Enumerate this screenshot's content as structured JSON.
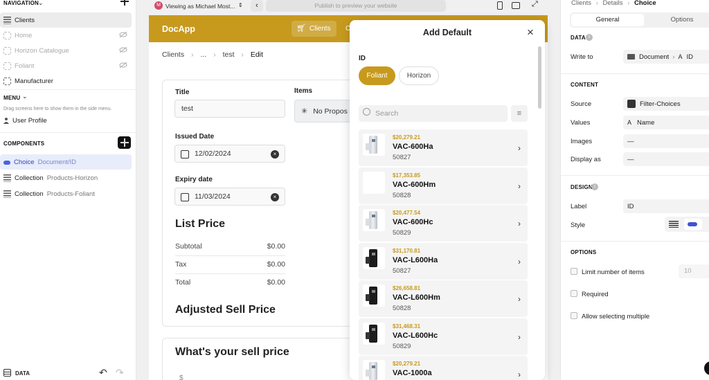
{
  "left_panel": {
    "navigation_header": "NAVIGATION",
    "nav_items": [
      {
        "label": "Clients"
      },
      {
        "label": "Home"
      },
      {
        "label": "Horizon Catalogue"
      },
      {
        "label": "Foliant"
      },
      {
        "label": "Manufacturer"
      }
    ],
    "menu_header": "MENU",
    "menu_hint": "Drag screens here to show them in the side menu.",
    "menu_item": "User Profile",
    "components_header": "COMPONENTS",
    "components": [
      {
        "type": "Choice",
        "source": "Document/ID"
      },
      {
        "type": "Collection",
        "source": "Products-Horizon"
      },
      {
        "type": "Collection",
        "source": "Products-Foliant"
      }
    ],
    "footer_label": "DATA"
  },
  "topbar": {
    "viewing_as": "Viewing as Michael Most...",
    "avatar_letter": "M",
    "publish_placeholder": "Publish to preview your website"
  },
  "app": {
    "title": "DocApp",
    "header_tab": "Clients",
    "header_tab2": "C",
    "breadcrumb": [
      "Clients",
      "...",
      "test",
      "Edit"
    ],
    "title_label": "Title",
    "title_value": "test",
    "items_label": "Items",
    "items_value": "No Propos",
    "issued_label": "Issued Date",
    "issued_value": "12/02/2024",
    "expiry_label": "Expiry date",
    "expiry_value": "11/03/2024",
    "list_price_heading": "List Price",
    "subtotal_label": "Subtotal",
    "subtotal_value": "$0.00",
    "tax_label": "Tax",
    "tax_value": "$0.00",
    "total_label": "Total",
    "total_value": "$0.00",
    "adjusted_heading": "Adjusted Sell Price",
    "sell_heading": "What's your sell price",
    "sell_prefix": "$"
  },
  "modal": {
    "title": "Add Default",
    "id_label": "ID",
    "chips": [
      "Foliant",
      "Horizon"
    ],
    "search_placeholder": "Search",
    "items": [
      {
        "price": "$20,279.21",
        "name": "VAC-600Ha",
        "code": "50827",
        "img": "silver"
      },
      {
        "price": "$17,353.85",
        "name": "VAC-600Hm",
        "code": "50828",
        "img": "none"
      },
      {
        "price": "$20,477.54",
        "name": "VAC-600Hc",
        "code": "50829",
        "img": "silver"
      },
      {
        "price": "$31,170.81",
        "name": "VAC-L600Ha",
        "code": "50827",
        "img": "black"
      },
      {
        "price": "$26,658.81",
        "name": "VAC-L600Hm",
        "code": "50828",
        "img": "black"
      },
      {
        "price": "$31,468.31",
        "name": "VAC-L600Hc",
        "code": "50829",
        "img": "black"
      },
      {
        "price": "$20,279.21",
        "name": "VAC-1000a",
        "code": "",
        "img": "silver"
      }
    ]
  },
  "right_panel": {
    "breadcrumb": [
      "Clients",
      "Details",
      "Choice"
    ],
    "tabs": [
      "General",
      "Options"
    ],
    "data_section": "DATA",
    "write_to_label": "Write to",
    "write_to_value": "Document",
    "write_to_field": "ID",
    "content_section": "CONTENT",
    "source_label": "Source",
    "source_value": "Filter-Choices",
    "values_label": "Values",
    "values_value": "Name",
    "images_label": "Images",
    "images_value": "—",
    "display_label": "Display as",
    "display_value": "—",
    "design_section": "DESIGN",
    "label_label": "Label",
    "label_value": "ID",
    "style_label": "Style",
    "options_section": "OPTIONS",
    "limit_label": "Limit number of items",
    "limit_value": "10",
    "required_label": "Required",
    "multiple_label": "Allow selecting multiple"
  },
  "colors": {
    "accent": "#c79a1e",
    "selected_tab_bg": "#ffffff"
  }
}
